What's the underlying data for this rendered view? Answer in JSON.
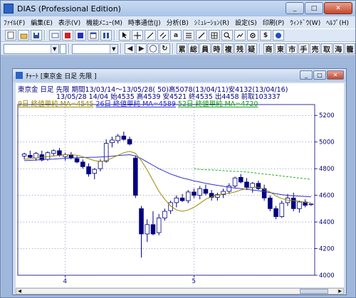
{
  "app": {
    "title": "DIAS (Professional Edition)",
    "window_buttons": {
      "minimize": "_",
      "maximize": "□",
      "close": "✕"
    }
  },
  "menu": [
    "ﾌｧｲﾙ(F)",
    "編集(E)",
    "表示(V)",
    "機能ﾒﾆｭｰ(M)",
    "時事通信(J)",
    "分析(B)",
    "ｼﾐｭﾚｰｼｮﾝ(R)",
    "設定(S)",
    "印刷(P)",
    "ｳｨﾝﾄﾞｳ(W)",
    "ﾍﾙﾌﾟ(H)"
  ],
  "toolbar2": {
    "nav": [
      "◀",
      "▶",
      "◯",
      "↻"
    ],
    "period_buttons": [
      "累",
      "総",
      "員",
      "時",
      "複",
      "残",
      "疑"
    ],
    "market_buttons": [
      "商",
      "東",
      "市",
      "手",
      "売",
      "取",
      "海",
      "籠"
    ]
  },
  "chart_window": {
    "title": "ﾁｬｰﾄ [東京金        日足 先限 ]",
    "info_line1": "東京金  日足  先限  期間13/03/14～13/05/28( 50)高5078(13/04/11)安4132(13/04/16)",
    "info_line2": "13/05/28 14/04 始4535 高4539 安4521 終4535 出4458 前取103337",
    "ma_labels": {
      "ma9": "9日 終値単純 MA=4545",
      "ma26": "26日 終値単純 MA=4589",
      "ma52": "52日 終値単純 MA=4720"
    }
  },
  "colors": {
    "candle": "#000080",
    "ma9": "#9a8a00",
    "ma26": "#3030d0",
    "ma52": "#22b022"
  },
  "chart_data": {
    "type": "candlestick",
    "y_ticks": [
      4000,
      4200,
      4400,
      4600,
      4800,
      5000,
      5200
    ],
    "ylim": [
      4000,
      5260
    ],
    "x_ticks": [
      "4",
      "5"
    ],
    "candles": [
      {
        "o": 4895,
        "h": 4920,
        "l": 4870,
        "c": 4910
      },
      {
        "o": 4900,
        "h": 4935,
        "l": 4880,
        "c": 4885
      },
      {
        "o": 4880,
        "h": 4925,
        "l": 4860,
        "c": 4915
      },
      {
        "o": 4905,
        "h": 4935,
        "l": 4855,
        "c": 4865
      },
      {
        "o": 4870,
        "h": 4930,
        "l": 4860,
        "c": 4920
      },
      {
        "o": 4915,
        "h": 4945,
        "l": 4895,
        "c": 4935
      },
      {
        "o": 4935,
        "h": 4955,
        "l": 4890,
        "c": 4900
      },
      {
        "o": 4890,
        "h": 4920,
        "l": 4860,
        "c": 4905
      },
      {
        "o": 4905,
        "h": 4925,
        "l": 4870,
        "c": 4880
      },
      {
        "o": 4875,
        "h": 4895,
        "l": 4840,
        "c": 4850
      },
      {
        "o": 4850,
        "h": 4870,
        "l": 4800,
        "c": 4815
      },
      {
        "o": 4815,
        "h": 4840,
        "l": 4740,
        "c": 4760
      },
      {
        "o": 4765,
        "h": 4805,
        "l": 4720,
        "c": 4795
      },
      {
        "o": 4800,
        "h": 4870,
        "l": 4780,
        "c": 4855
      },
      {
        "o": 4855,
        "h": 5020,
        "l": 4845,
        "c": 4990
      },
      {
        "o": 4995,
        "h": 5040,
        "l": 4960,
        "c": 5015
      },
      {
        "o": 5010,
        "h": 5060,
        "l": 4990,
        "c": 5045
      },
      {
        "o": 5045,
        "h": 5078,
        "l": 5010,
        "c": 5020
      },
      {
        "o": 5020,
        "h": 5040,
        "l": 4975,
        "c": 4985
      },
      {
        "o": 4880,
        "h": 4900,
        "l": 4580,
        "c": 4600
      },
      {
        "o": 4500,
        "h": 4520,
        "l": 4132,
        "c": 4310
      },
      {
        "o": 4310,
        "h": 4420,
        "l": 4250,
        "c": 4380
      },
      {
        "o": 4380,
        "h": 4480,
        "l": 4300,
        "c": 4310
      },
      {
        "o": 4320,
        "h": 4460,
        "l": 4300,
        "c": 4430
      },
      {
        "o": 4430,
        "h": 4500,
        "l": 4410,
        "c": 4480
      },
      {
        "o": 4485,
        "h": 4560,
        "l": 4460,
        "c": 4545
      },
      {
        "o": 4545,
        "h": 4600,
        "l": 4510,
        "c": 4580
      },
      {
        "o": 4580,
        "h": 4610,
        "l": 4550,
        "c": 4560
      },
      {
        "o": 4560,
        "h": 4640,
        "l": 4540,
        "c": 4625
      },
      {
        "o": 4625,
        "h": 4650,
        "l": 4580,
        "c": 4600
      },
      {
        "o": 4600,
        "h": 4670,
        "l": 4570,
        "c": 4650
      },
      {
        "o": 4645,
        "h": 4680,
        "l": 4600,
        "c": 4615
      },
      {
        "o": 4615,
        "h": 4640,
        "l": 4560,
        "c": 4585
      },
      {
        "o": 4585,
        "h": 4620,
        "l": 4560,
        "c": 4605
      },
      {
        "o": 4605,
        "h": 4650,
        "l": 4580,
        "c": 4630
      },
      {
        "o": 4630,
        "h": 4690,
        "l": 4610,
        "c": 4670
      },
      {
        "o": 4670,
        "h": 4740,
        "l": 4650,
        "c": 4730
      },
      {
        "o": 4735,
        "h": 4760,
        "l": 4690,
        "c": 4700
      },
      {
        "o": 4700,
        "h": 4730,
        "l": 4640,
        "c": 4660
      },
      {
        "o": 4660,
        "h": 4700,
        "l": 4620,
        "c": 4690
      },
      {
        "o": 4690,
        "h": 4710,
        "l": 4640,
        "c": 4650
      },
      {
        "o": 4650,
        "h": 4680,
        "l": 4560,
        "c": 4580
      },
      {
        "o": 4580,
        "h": 4600,
        "l": 4480,
        "c": 4500
      },
      {
        "o": 4500,
        "h": 4520,
        "l": 4420,
        "c": 4440
      },
      {
        "o": 4440,
        "h": 4560,
        "l": 4430,
        "c": 4540
      },
      {
        "o": 4545,
        "h": 4610,
        "l": 4520,
        "c": 4580
      },
      {
        "o": 4580,
        "h": 4620,
        "l": 4480,
        "c": 4500
      },
      {
        "o": 4500,
        "h": 4560,
        "l": 4470,
        "c": 4550
      },
      {
        "o": 4550,
        "h": 4570,
        "l": 4510,
        "c": 4525
      },
      {
        "o": 4535,
        "h": 4539,
        "l": 4521,
        "c": 4535
      }
    ],
    "ma9": [
      4870,
      4875,
      4880,
      4885,
      4890,
      4895,
      4900,
      4905,
      4905,
      4900,
      4890,
      4875,
      4860,
      4855,
      4860,
      4880,
      4900,
      4920,
      4930,
      4915,
      4860,
      4790,
      4710,
      4630,
      4570,
      4520,
      4490,
      4480,
      4490,
      4510,
      4540,
      4570,
      4590,
      4600,
      4610,
      4615,
      4625,
      4640,
      4650,
      4660,
      4660,
      4645,
      4625,
      4595,
      4575,
      4565,
      4560,
      4555,
      4548,
      4545
    ],
    "ma26": [
      4860,
      4862,
      4865,
      4868,
      4870,
      4872,
      4875,
      4878,
      4880,
      4882,
      4884,
      4885,
      4886,
      4888,
      4890,
      4894,
      4898,
      4902,
      4905,
      4895,
      4875,
      4850,
      4825,
      4800,
      4780,
      4760,
      4745,
      4730,
      4720,
      4708,
      4700,
      4690,
      4682,
      4675,
      4668,
      4660,
      4655,
      4650,
      4645,
      4640,
      4635,
      4628,
      4620,
      4612,
      4605,
      4600,
      4596,
      4593,
      4591,
      4589
    ],
    "ma52": [
      null,
      null,
      null,
      null,
      null,
      null,
      null,
      null,
      null,
      null,
      null,
      null,
      null,
      null,
      null,
      null,
      null,
      null,
      null,
      null,
      null,
      null,
      null,
      null,
      null,
      null,
      null,
      null,
      null,
      4800,
      4795,
      4792,
      4790,
      4788,
      4785,
      4782,
      4780,
      4778,
      4775,
      4770,
      4765,
      4760,
      4755,
      4750,
      4745,
      4740,
      4735,
      4730,
      4725,
      4720
    ]
  }
}
